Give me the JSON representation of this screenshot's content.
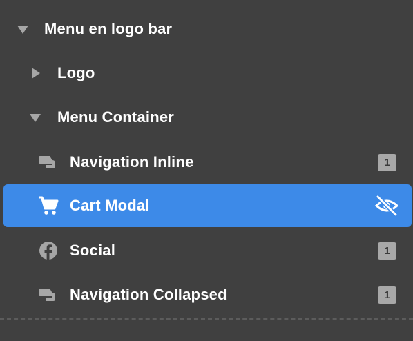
{
  "tree": {
    "items": [
      {
        "label": "Menu en logo bar",
        "icon": "caret-down-icon"
      },
      {
        "label": "Logo",
        "icon": "caret-right-icon"
      },
      {
        "label": "Menu Container",
        "icon": "caret-down-icon"
      },
      {
        "label": "Navigation Inline",
        "icon": "navigation-icon",
        "badge": "1"
      },
      {
        "label": "Cart Modal",
        "icon": "cart-icon",
        "status_icon": "hidden-eye-icon",
        "selected": true
      },
      {
        "label": "Social",
        "icon": "facebook-icon",
        "badge": "1"
      },
      {
        "label": "Navigation Collapsed",
        "icon": "navigation-icon",
        "badge": "1"
      }
    ]
  },
  "colors": {
    "background": "#404040",
    "selected": "#3d8ae8",
    "badge": "#a8a8a8",
    "icon_gray": "#a6a6a6"
  }
}
